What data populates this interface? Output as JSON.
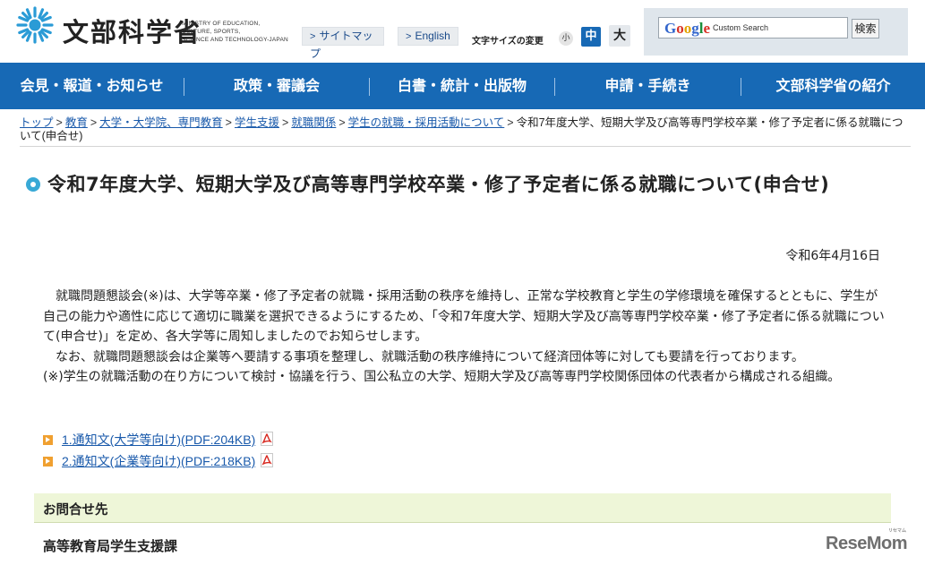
{
  "header": {
    "logo_jp": "文部科学省",
    "logo_en": [
      "MINISTRY OF EDUCATION,",
      "CULTURE, SPORTS,",
      "SCIENCE AND TECHNOLOGY-JAPAN"
    ],
    "sitemap_label": "サイトマップ",
    "english_label": "English",
    "font_size_label": "文字サイズの変更",
    "font_sizes": {
      "small": "小",
      "medium": "中",
      "large": "大"
    },
    "search": {
      "brand": "Google",
      "brand_suffix": "Custom Search",
      "button_label": "検索",
      "value": ""
    }
  },
  "nav": {
    "items": [
      "会見・報道・お知らせ",
      "政策・審議会",
      "白書・統計・出版物",
      "申請・手続き",
      "文部科学省の紹介"
    ]
  },
  "breadcrumb": {
    "links": [
      "トップ",
      "教育",
      "大学・大学院、専門教育",
      "学生支援",
      "就職関係",
      "学生の就職・採用活動について"
    ],
    "current": "令和7年度大学、短期大学及び高等専門学校卒業・修了予定者に係る就職について(申合せ)"
  },
  "page": {
    "title": "令和7年度大学、短期大学及び高等専門学校卒業・修了予定者に係る就職について(申合せ)",
    "date": "令和6年4月16日",
    "paragraphs": [
      "就職問題懇談会(※)は、大学等卒業・修了予定者の就職・採用活動の秩序を維持し、正常な学校教育と学生の学修環境を確保するとともに、学生が自己の能力や適性に応じて適切に職業を選択できるようにするため、「令和7年度大学、短期大学及び高等専門学校卒業・修了予定者に係る就職について(申合せ)」を定め、各大学等に周知しましたのでお知らせします。",
      "なお、就職問題懇談会は企業等へ要請する事項を整理し、就職活動の秩序維持について経済団体等に対しても要請を行っております。",
      "(※)学生の就職活動の在り方について検討・協議を行う、国公私立の大学、短期大学及び高等専門学校関係団体の代表者から構成される組織。"
    ],
    "documents": [
      {
        "label": "1.通知文(大学等向け)(PDF:204KB)",
        "icon": "pdf-icon"
      },
      {
        "label": "2.通知文(企業等向け)(PDF:218KB)",
        "icon": "pdf-icon"
      }
    ],
    "contact": {
      "heading": "お問合せ先",
      "department": "高等教育局学生支援課"
    }
  },
  "watermark": {
    "text": "ReseMom",
    "kana": "リセマム"
  },
  "colors": {
    "nav_bg": "#1769b5",
    "link": "#1a5aab",
    "title_bullet": "#38a9d6",
    "contact_bg": "#eef6d8",
    "doc_arrow": "#f0a030",
    "pdf_red": "#d7261e"
  }
}
